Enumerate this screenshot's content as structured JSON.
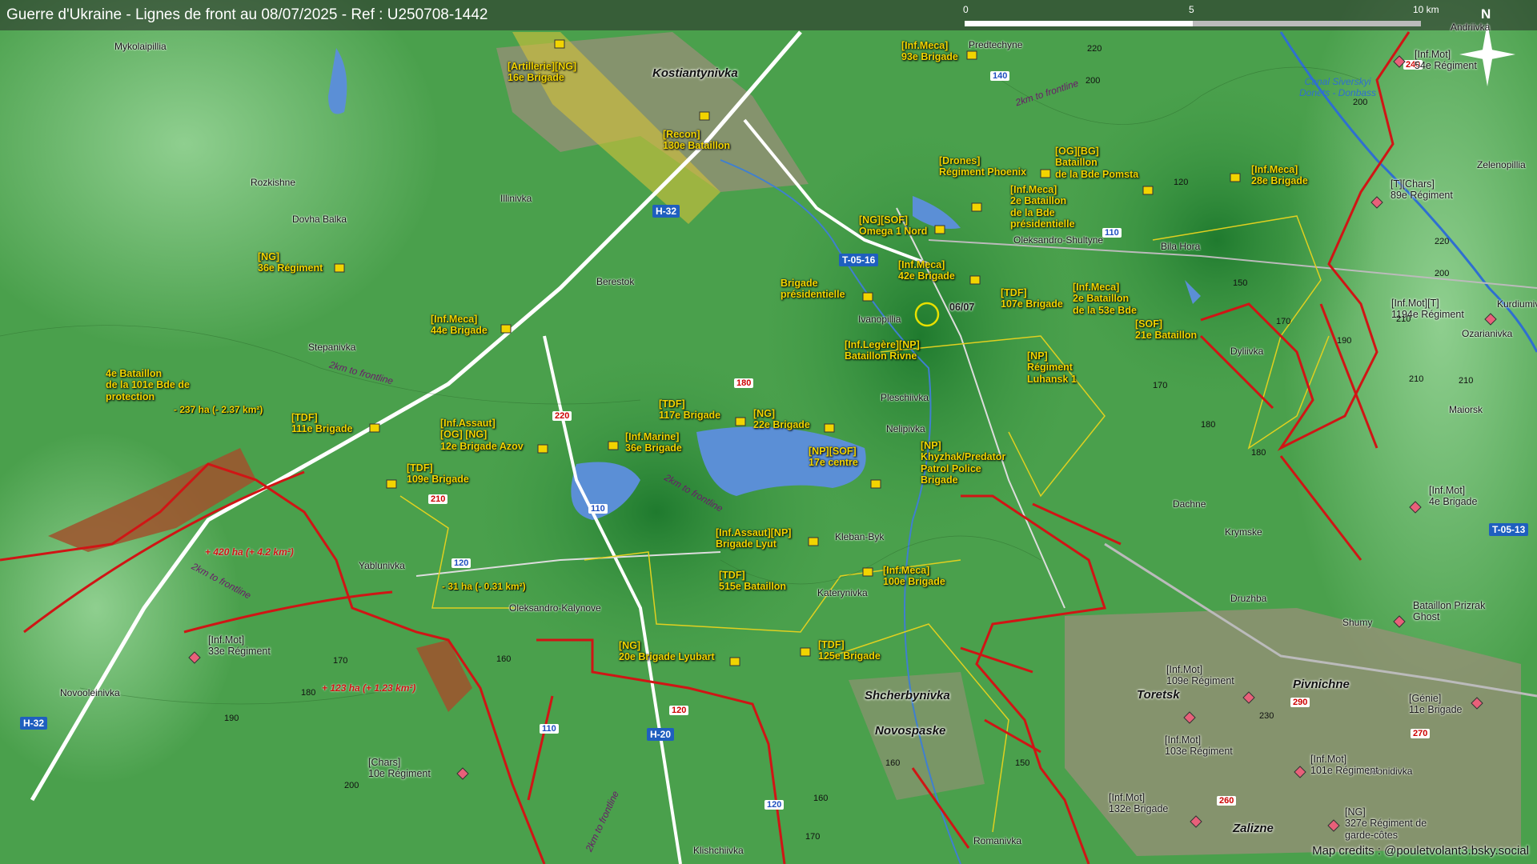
{
  "title": "Guerre d'Ukraine - Lignes de front au 08/07/2025 - Ref : U250708-1442",
  "scale_bar": {
    "labels": [
      "0",
      "5",
      "10 km"
    ]
  },
  "north_label": "N",
  "credits": "Map credits : @pouletvolant3.bsky.social",
  "colors": {
    "ua_units": "#f2d400",
    "front_line": "#d01515",
    "russian_gain": "#a0522d",
    "water": "#5b8fd6",
    "terrain": "#3f8f3f"
  },
  "cities": [
    "Kostiantynivka",
    "Shcherbynivka",
    "Novospaske",
    "Toretsk",
    "Pivnichne",
    "Zalizne"
  ],
  "towns": [
    "Mykolaipillia",
    "Rozkishne",
    "Dovha Balka",
    "Illinivka",
    "Berestok",
    "Stepanivka",
    "Yablunivka",
    "Novooleinivka",
    "Oleksandro-Kalynove",
    "Predtechyne",
    "Oleksandro-Shultyne",
    "Bila Hora",
    "Ivanopillia",
    "Pleschiivka",
    "Nelipivka",
    "Kleban-Byk",
    "Katerynivka",
    "Dyliivka",
    "Dachne",
    "Krymske",
    "Druzhba",
    "Shumy",
    "Leonidivka",
    "Romanivka",
    "Klishchiivka",
    "Andriivka",
    "Zelenopillia",
    "Kurdiumivka",
    "Ozarianivka",
    "Maiorsk"
  ],
  "roads": [
    "H-32",
    "T-05-16",
    "H-20",
    "T-05-13",
    "H-32"
  ],
  "secondary_roads": [
    "240",
    "290",
    "260",
    "270",
    "230",
    "220",
    "210",
    "180",
    "110",
    "120",
    "140",
    "110",
    "120",
    "110",
    "120"
  ],
  "canal": "Canal Siverskyi\nDonets - Donbass",
  "front_notes": [
    "2km to frontline",
    "2km to frontline",
    "2km to frontline",
    "2km to frontline",
    "2km to frontline"
  ],
  "area_changes": {
    "loss_yellow": [
      "- 237 ha (- 2.37 km²)",
      "- 31 ha (- 0.31 km²)"
    ],
    "gain_red": [
      "+ 420 ha (+ 4.2 km²)",
      "+ 123 ha (+ 1.23 km²)"
    ]
  },
  "date_marker": "06/07",
  "ua_units": [
    "[Artillerie][NG]\n16e Brigade",
    "[Recon]\n130e Bataillon",
    "[Inf.Meca]\n93e Brigade",
    "[Drones]\nRégiment Phoenix",
    "[OG][BG]\nBataillon\nde la Bde Pomsta",
    "[Inf.Meca]\n28e Brigade",
    "[Inf.Meca]\n2e Bataillon\nde la Bde\nprésidentielle",
    "[NG][SOF]\nOmega 1 Nord",
    "[Inf.Meca]\n42e Brigade",
    "[TDF]\n107e Brigade",
    "[Inf.Meca]\n2e Bataillon\nde la 53e Bde",
    "[SOF]\n21e Bataillon",
    "Brigade\nprésidentielle",
    "[Inf.Legère][NP]\nBataillon Rivne",
    "[NP]\nRégiment\nLuhansk 1",
    "[NG]\n36e Régiment",
    "[Inf.Meca]\n44e Brigade",
    "4e Bataillon\nde la 101e Bde de\nprotection",
    "[TDF]\n111e Brigade",
    "[Inf.Assaut]\n[OG] [NG]\n12e Brigade Azov",
    "[TDF]\n109e Brigade",
    "[Inf.Marine]\n36e Brigade",
    "[TDF]\n117e Brigade",
    "[NG]\n22e Brigade",
    "[NP][SOF]\n17e centre",
    "[NP]\nKhyzhak/Predator\nPatrol Police\nBrigade",
    "[Inf.Assaut][NP]\nBrigade Lyut",
    "[TDF]\n515e Bataillon",
    "[Inf.Meca]\n100e Brigade",
    "[NG]\n20e Brigade Lyubart",
    "[TDF]\n125e Brigade"
  ],
  "ru_units": [
    "[Inf.Mot]\n54e Régiment",
    "[T][Chars]\n89e Régiment",
    "[Inf.Mot][T]\n1194e Régiment",
    "[Inf.Mot]\n4e Brigade",
    "Bataillon Prizrak\nGhost",
    "[Inf.Mot]\n109e Régiment",
    "[Génie]\n11e Brigade",
    "[Inf.Mot]\n103e Régiment",
    "[Inf.Mot]\n101e Régiment",
    "[Inf.Mot]\n132e Brigade",
    "[NG]\n327e Régiment de\ngarde-côtes",
    "[Inf.Mot]\n33e Régiment",
    "[Chars]\n10e Régiment"
  ],
  "elevations": [
    "220",
    "200",
    "220",
    "210",
    "200",
    "170",
    "160",
    "190",
    "180",
    "150",
    "170",
    "190",
    "180",
    "200",
    "210",
    "170",
    "160",
    "180",
    "190",
    "200",
    "170",
    "160",
    "150",
    "230",
    "240",
    "120",
    "210",
    "220",
    "190"
  ]
}
